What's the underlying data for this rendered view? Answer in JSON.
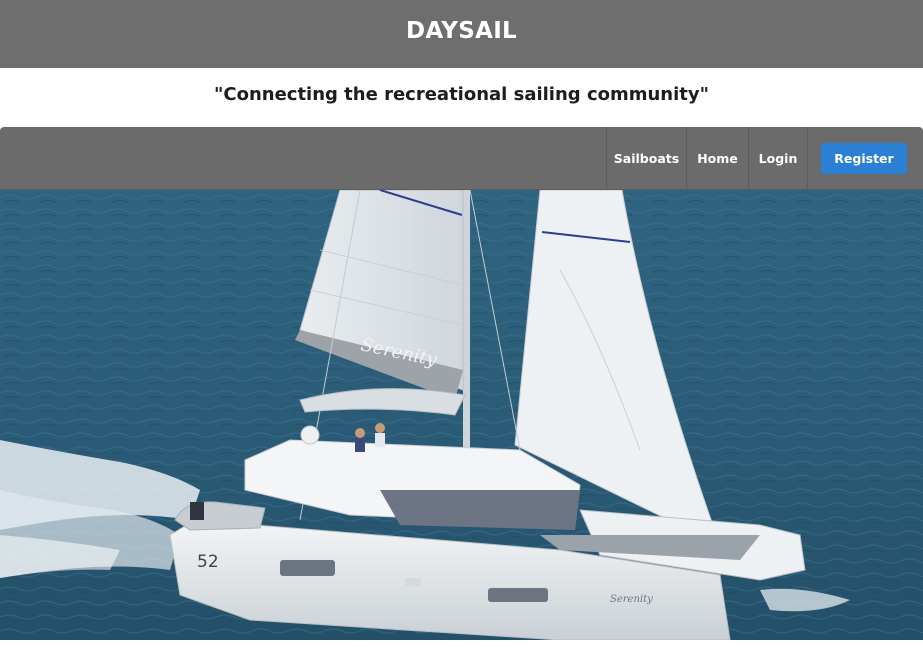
{
  "site": {
    "title": "DAYSAIL",
    "tagline": "\"Connecting the recreational sailing community\""
  },
  "nav": {
    "items": [
      {
        "label": "Sailboats"
      },
      {
        "label": "Home"
      },
      {
        "label": "Login"
      }
    ],
    "register_label": "Register"
  },
  "hero": {
    "sail_name": "Serenity",
    "hull_number": "52",
    "hull_name": "Serenity"
  },
  "colors": {
    "header_bg": "#6e6e6e",
    "nav_bg": "#6b6b6b",
    "register_bg": "#2b7fd4",
    "sea": "#2c5f7a"
  }
}
